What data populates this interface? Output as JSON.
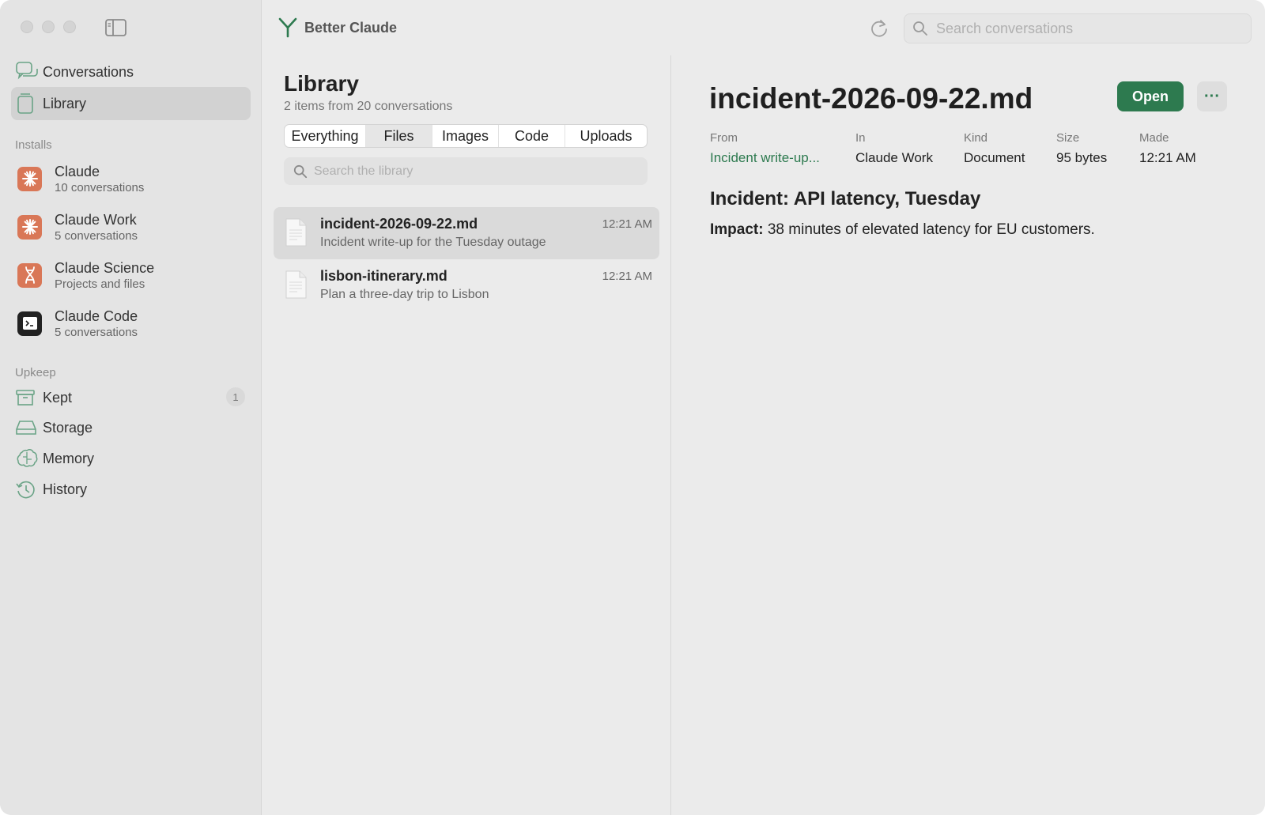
{
  "app": {
    "title": "Better Claude",
    "accent_color": "#2d7a4f"
  },
  "search": {
    "placeholder": "Search conversations"
  },
  "sidebar": {
    "nav": [
      {
        "label": "Conversations",
        "icon": "conversations-icon"
      },
      {
        "label": "Library",
        "icon": "library-icon",
        "selected": true
      }
    ],
    "installs_header": "Installs",
    "installs": [
      {
        "name": "Claude",
        "subtitle": "10 conversations",
        "icon": "claude-sunburst-icon",
        "color": "#d97757"
      },
      {
        "name": "Claude Work",
        "subtitle": "5 conversations",
        "icon": "claude-sunburst-icon",
        "color": "#d97757"
      },
      {
        "name": "Claude Science",
        "subtitle": "Projects and files",
        "icon": "dna-icon",
        "color": "#d97757"
      },
      {
        "name": "Claude Code",
        "subtitle": "5 conversations",
        "icon": "terminal-icon",
        "color": "#222222"
      }
    ],
    "upkeep_header": "Upkeep",
    "upkeep": [
      {
        "label": "Kept",
        "icon": "archive-box-icon",
        "badge": "1"
      },
      {
        "label": "Storage",
        "icon": "drive-icon"
      },
      {
        "label": "Memory",
        "icon": "brain-icon"
      },
      {
        "label": "History",
        "icon": "clock-history-icon"
      }
    ]
  },
  "library": {
    "title": "Library",
    "subtitle": "2 items from 20 conversations",
    "tabs": [
      {
        "label": "Everything"
      },
      {
        "label": "Files",
        "active": true
      },
      {
        "label": "Images"
      },
      {
        "label": "Code"
      },
      {
        "label": "Uploads"
      }
    ],
    "search_placeholder": "Search the library",
    "items": [
      {
        "name": "incident-2026-09-22.md",
        "description": "Incident write-up for the Tuesday outage",
        "time": "12:21 AM",
        "selected": true
      },
      {
        "name": "lisbon-itinerary.md",
        "description": "Plan a three-day trip to Lisbon",
        "time": "12:21 AM"
      }
    ]
  },
  "detail": {
    "title": "incident-2026-09-22.md",
    "open_label": "Open",
    "more_label": "···",
    "meta": [
      {
        "label": "From",
        "value": "Incident write-up..."
      },
      {
        "label": "In",
        "value": "Claude Work"
      },
      {
        "label": "Kind",
        "value": "Document"
      },
      {
        "label": "Size",
        "value": "95 bytes"
      },
      {
        "label": "Made",
        "value": "12:21 AM"
      }
    ],
    "content": {
      "heading": "Incident: API latency, Tuesday",
      "impact_label": "Impact:",
      "impact_text": "38 minutes of elevated latency for EU customers."
    }
  }
}
